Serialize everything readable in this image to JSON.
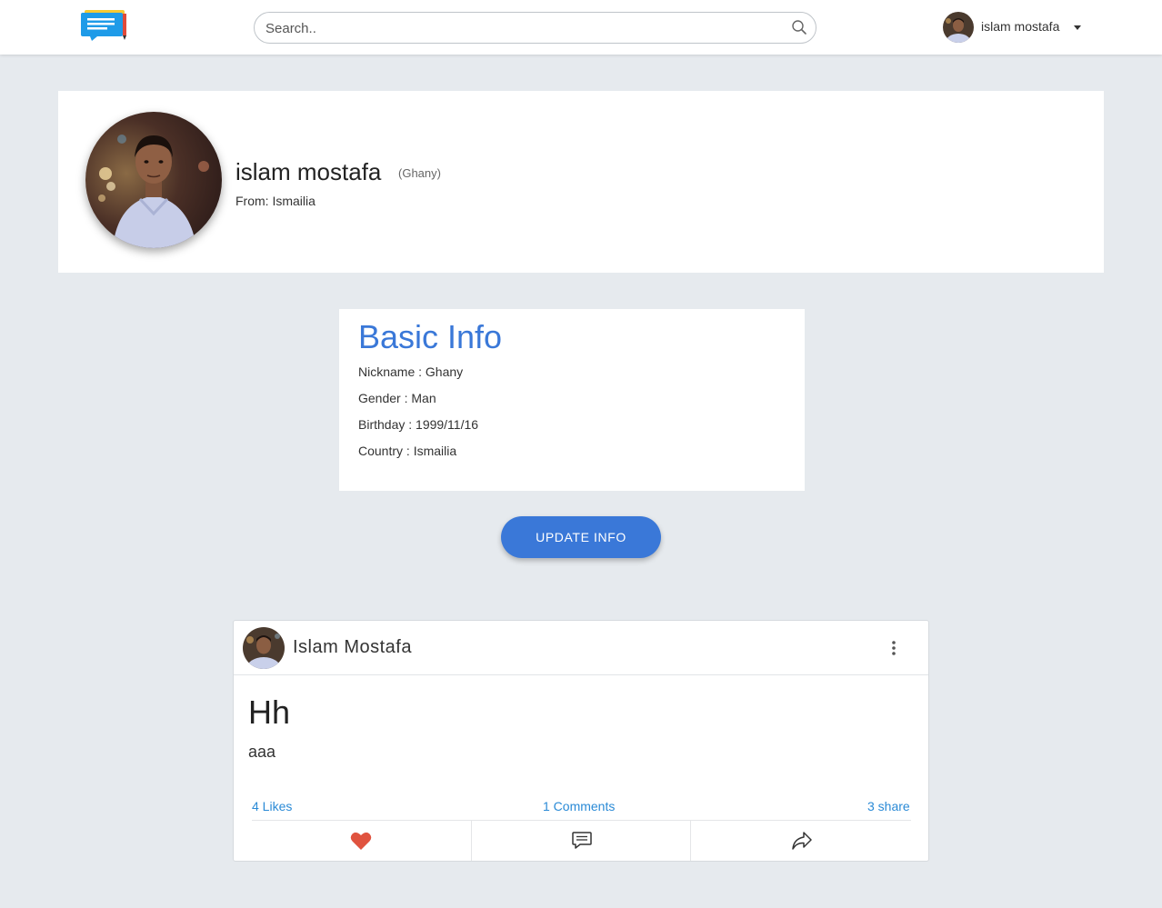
{
  "topbar": {
    "logo": "chat-logo",
    "search": {
      "placeholder": "Search..",
      "value": ""
    },
    "user": {
      "name": "islam mostafa"
    }
  },
  "profile": {
    "name": "islam mostafa",
    "nickname": "(Ghany)",
    "from": "From: Ismailia"
  },
  "basic_info": {
    "title": "Basic Info",
    "rows": [
      "Nickname : Ghany",
      "Gender : Man",
      "Birthday : 1999/11/16",
      "Country : Ismailia"
    ],
    "update_button": "UPDATE INFO"
  },
  "post": {
    "author": "Islam Mostafa",
    "title": "Hh",
    "body": "aaa",
    "likes": "4 Likes",
    "comments": "1 Comments",
    "shares": "3 share",
    "actions": [
      "heart-icon",
      "comment-icon",
      "share-icon"
    ]
  },
  "colors": {
    "accent": "#3a78d8",
    "link": "#2a8ad6",
    "heart": "#e0533f",
    "background": "#e6eaee"
  }
}
